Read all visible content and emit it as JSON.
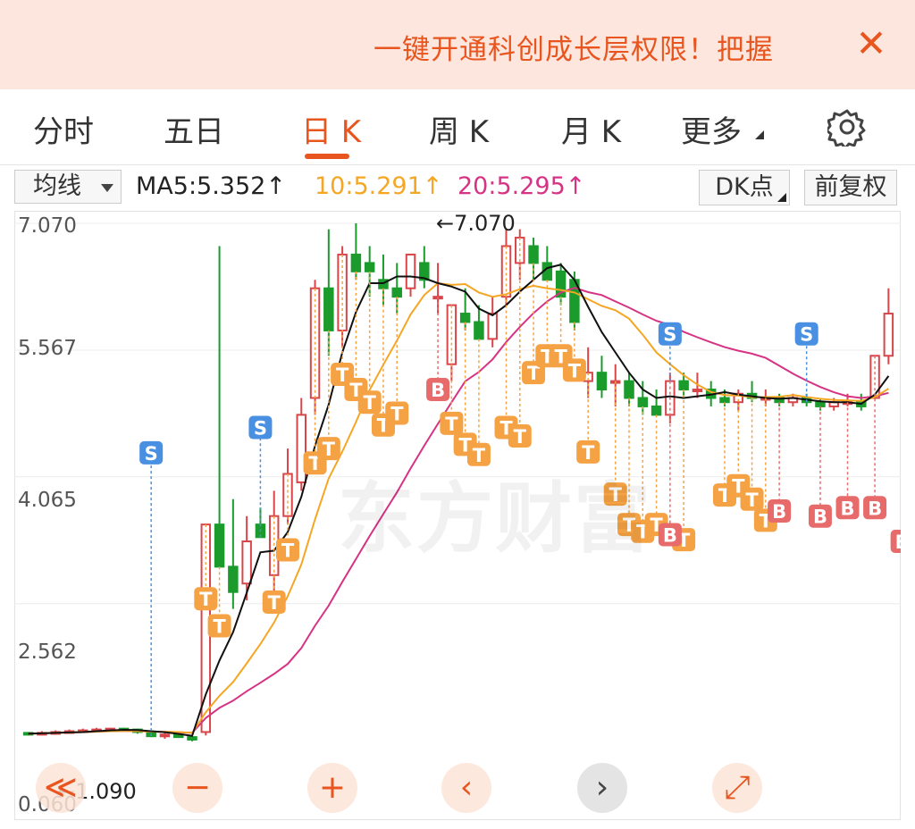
{
  "banner": {
    "text": "一键开通科创成长层权限！把握",
    "close": "✕"
  },
  "tabs": [
    {
      "label": "分时",
      "active": false
    },
    {
      "label": "五日",
      "active": false
    },
    {
      "label": "日 K",
      "active": true
    },
    {
      "label": "周 K",
      "active": false
    },
    {
      "label": "月 K",
      "active": false
    },
    {
      "label": "更多",
      "active": false
    }
  ],
  "toolbar": {
    "indicator": "均线",
    "ma5": "MA5:5.352↑",
    "ma10": "10:5.291↑",
    "ma20": "20:5.295↑",
    "dk_button": "DK点",
    "adjust_button": "前复权"
  },
  "colors": {
    "accent": "#e8551e",
    "up": "#d8454a",
    "down": "#1a9b2c",
    "ma5": "#111111",
    "ma10": "#f5a623",
    "ma20": "#d63384",
    "signal_t": "#f5a244",
    "signal_b": "#e86b6b",
    "signal_s": "#4a90e2"
  },
  "chart": {
    "y_ticks": [
      "7.070",
      "5.567",
      "4.065",
      "2.562"
    ],
    "y_min_label": "0.060",
    "high_marker": "←7.070",
    "low_marker": "←1.090",
    "watermark": "东方财富",
    "signal_letters": {
      "t": "T",
      "b": "B",
      "s": "S"
    }
  },
  "controls": [
    {
      "name": "scroll-left-most",
      "glyph": "≪"
    },
    {
      "name": "zoom-out",
      "glyph": "−"
    },
    {
      "name": "zoom-in",
      "glyph": "+"
    },
    {
      "name": "prev",
      "glyph": "‹"
    },
    {
      "name": "next",
      "glyph": "›"
    },
    {
      "name": "fullscreen",
      "glyph": "⤢"
    }
  ],
  "chart_data": {
    "type": "candlestick",
    "ylim": [
      0.06,
      7.07
    ],
    "candles": [
      [
        1.03,
        1.04,
        1.0,
        1.02
      ],
      [
        1.02,
        1.05,
        1.0,
        1.03
      ],
      [
        1.03,
        1.06,
        1.01,
        1.04
      ],
      [
        1.04,
        1.07,
        1.02,
        1.05
      ],
      [
        1.05,
        1.08,
        1.03,
        1.06
      ],
      [
        1.06,
        1.09,
        1.04,
        1.07
      ],
      [
        1.07,
        1.09,
        1.05,
        1.08
      ],
      [
        1.08,
        1.09,
        1.05,
        1.07
      ],
      [
        1.07,
        1.08,
        1.02,
        1.04
      ],
      [
        1.04,
        1.06,
        0.98,
        0.99
      ],
      [
        0.99,
        1.03,
        0.96,
        1.01
      ],
      [
        1.01,
        1.02,
        0.97,
        0.98
      ],
      [
        0.98,
        0.99,
        0.93,
        0.95
      ],
      [
        1.04,
        3.5,
        1.0,
        3.5
      ],
      [
        3.5,
        6.8,
        3.0,
        3.0
      ],
      [
        3.0,
        3.8,
        2.5,
        2.7
      ],
      [
        2.8,
        3.6,
        2.6,
        3.3
      ],
      [
        3.5,
        3.7,
        3.4,
        3.35
      ],
      [
        2.9,
        3.9,
        2.7,
        3.6
      ],
      [
        3.6,
        4.4,
        3.5,
        4.1
      ],
      [
        4.0,
        5.0,
        3.9,
        4.8
      ],
      [
        5.0,
        6.4,
        4.8,
        6.3
      ],
      [
        6.3,
        7.0,
        5.5,
        5.8
      ],
      [
        5.8,
        6.8,
        5.6,
        6.7
      ],
      [
        6.7,
        7.07,
        6.4,
        6.5
      ],
      [
        6.6,
        6.8,
        6.2,
        6.5
      ],
      [
        6.4,
        6.7,
        6.1,
        6.3
      ],
      [
        6.3,
        6.6,
        6.0,
        6.2
      ],
      [
        6.3,
        6.7,
        6.2,
        6.7
      ],
      [
        6.6,
        6.8,
        6.3,
        6.4
      ],
      [
        6.2,
        6.6,
        6.0,
        6.2
      ],
      [
        5.4,
        6.1,
        5.2,
        6.1
      ],
      [
        6.0,
        6.3,
        5.8,
        5.9
      ],
      [
        5.9,
        6.1,
        5.7,
        5.7
      ],
      [
        5.7,
        6.2,
        5.6,
        6.0
      ],
      [
        6.2,
        7.0,
        6.1,
        6.8
      ],
      [
        6.6,
        7.0,
        6.4,
        6.9
      ],
      [
        6.8,
        6.9,
        6.4,
        6.6
      ],
      [
        6.6,
        6.8,
        6.4,
        6.4
      ],
      [
        6.5,
        6.6,
        6.1,
        6.2
      ],
      [
        6.4,
        6.5,
        5.8,
        5.9
      ],
      [
        5.2,
        5.6,
        5.0,
        5.3
      ],
      [
        5.3,
        5.5,
        5.0,
        5.1
      ],
      [
        5.2,
        5.4,
        4.9,
        5.2
      ],
      [
        5.2,
        5.3,
        4.9,
        5.0
      ],
      [
        5.0,
        5.2,
        4.8,
        4.9
      ],
      [
        4.9,
        5.1,
        4.8,
        4.8
      ],
      [
        4.8,
        5.3,
        4.7,
        5.2
      ],
      [
        5.2,
        5.3,
        5.0,
        5.1
      ],
      [
        5.1,
        5.3,
        5.0,
        5.1
      ],
      [
        5.1,
        5.2,
        4.9,
        5.0
      ],
      [
        5.0,
        5.1,
        4.9,
        4.95
      ],
      [
        4.95,
        5.1,
        4.85,
        5.05
      ],
      [
        5.05,
        5.2,
        4.95,
        5.0
      ],
      [
        5.0,
        5.1,
        4.9,
        5.0
      ],
      [
        5.0,
        5.05,
        4.9,
        4.95
      ],
      [
        4.95,
        5.05,
        4.9,
        5.0
      ],
      [
        5.0,
        5.05,
        4.9,
        4.95
      ],
      [
        4.95,
        5.0,
        4.85,
        4.9
      ],
      [
        4.9,
        5.0,
        4.85,
        4.95
      ],
      [
        4.95,
        5.05,
        4.9,
        4.95
      ],
      [
        4.95,
        5.05,
        4.85,
        4.9
      ],
      [
        5.0,
        5.5,
        5.0,
        5.5
      ],
      [
        5.5,
        6.3,
        5.4,
        6.0
      ]
    ],
    "signals": {
      "T": [
        [
          13,
          2.62
        ],
        [
          14,
          2.3
        ],
        [
          18,
          2.58
        ],
        [
          19,
          3.2
        ],
        [
          21,
          4.23
        ],
        [
          22,
          4.4
        ],
        [
          23,
          5.28
        ],
        [
          24,
          5.1
        ],
        [
          25,
          4.95
        ],
        [
          26,
          4.68
        ],
        [
          27,
          4.82
        ],
        [
          31,
          4.7
        ],
        [
          32,
          4.45
        ],
        [
          33,
          4.33
        ],
        [
          35,
          4.65
        ],
        [
          36,
          4.55
        ],
        [
          37,
          5.3
        ],
        [
          38,
          5.5
        ],
        [
          39,
          5.5
        ],
        [
          40,
          5.33
        ],
        [
          41,
          4.36
        ],
        [
          43,
          3.86
        ],
        [
          44,
          3.5
        ],
        [
          45,
          3.42
        ],
        [
          46,
          3.5
        ],
        [
          48,
          3.32
        ],
        [
          51,
          3.85
        ],
        [
          52,
          3.96
        ],
        [
          53,
          3.8
        ],
        [
          54,
          3.55
        ]
      ],
      "B": [
        [
          30,
          5.1
        ],
        [
          47,
          3.38
        ],
        [
          55,
          3.66
        ],
        [
          58,
          3.6
        ],
        [
          60,
          3.7
        ],
        [
          62,
          3.7
        ],
        [
          64,
          3.3
        ]
      ],
      "S": [
        [
          9,
          4.35
        ],
        [
          17,
          4.65
        ],
        [
          47,
          5.76
        ],
        [
          57,
          5.76
        ]
      ]
    },
    "ma5_close": [
      5.352
    ],
    "ma10_close": [
      5.291
    ],
    "ma20_close": [
      5.295
    ]
  }
}
